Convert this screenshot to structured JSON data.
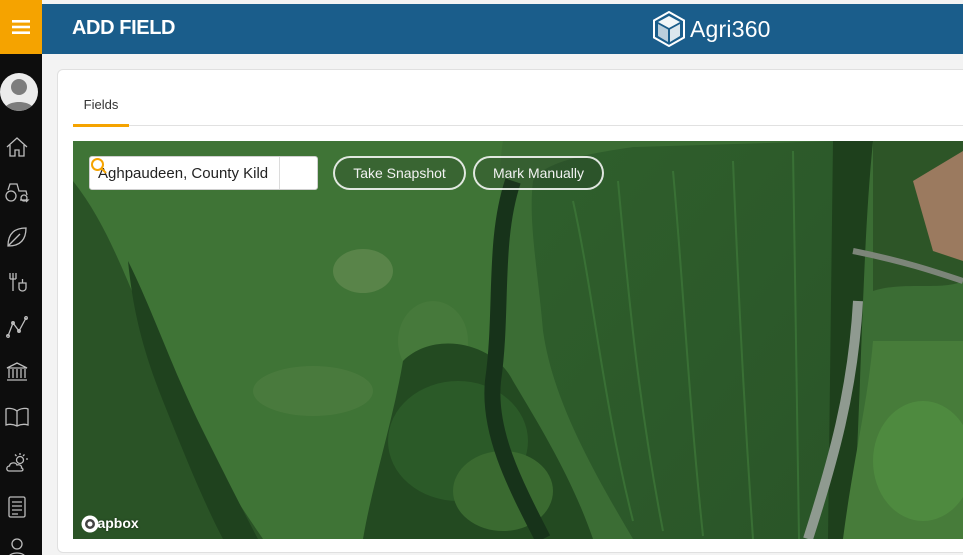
{
  "header": {
    "title": "ADD FIELD",
    "logo_text": "Agri360"
  },
  "sidebar": {
    "items": [
      {
        "icon": "home-icon"
      },
      {
        "icon": "tractor-icon"
      },
      {
        "icon": "leaf-icon"
      },
      {
        "icon": "fork-cup-icon"
      },
      {
        "icon": "analytics-icon"
      },
      {
        "icon": "bank-icon"
      },
      {
        "icon": "book-icon"
      },
      {
        "icon": "weather-icon"
      },
      {
        "icon": "list-icon"
      },
      {
        "icon": "user-icon"
      }
    ]
  },
  "tabs": [
    {
      "label": "Fields",
      "active": true
    }
  ],
  "map": {
    "search_value": "Aghpaudeen, County Kild",
    "take_snapshot_label": "Take Snapshot",
    "mark_manually_label": "Mark Manually",
    "attribution": "mapbox"
  },
  "colors": {
    "accent": "#f5a300",
    "header": "#1a5d8b",
    "rail": "#0d0d0d"
  }
}
